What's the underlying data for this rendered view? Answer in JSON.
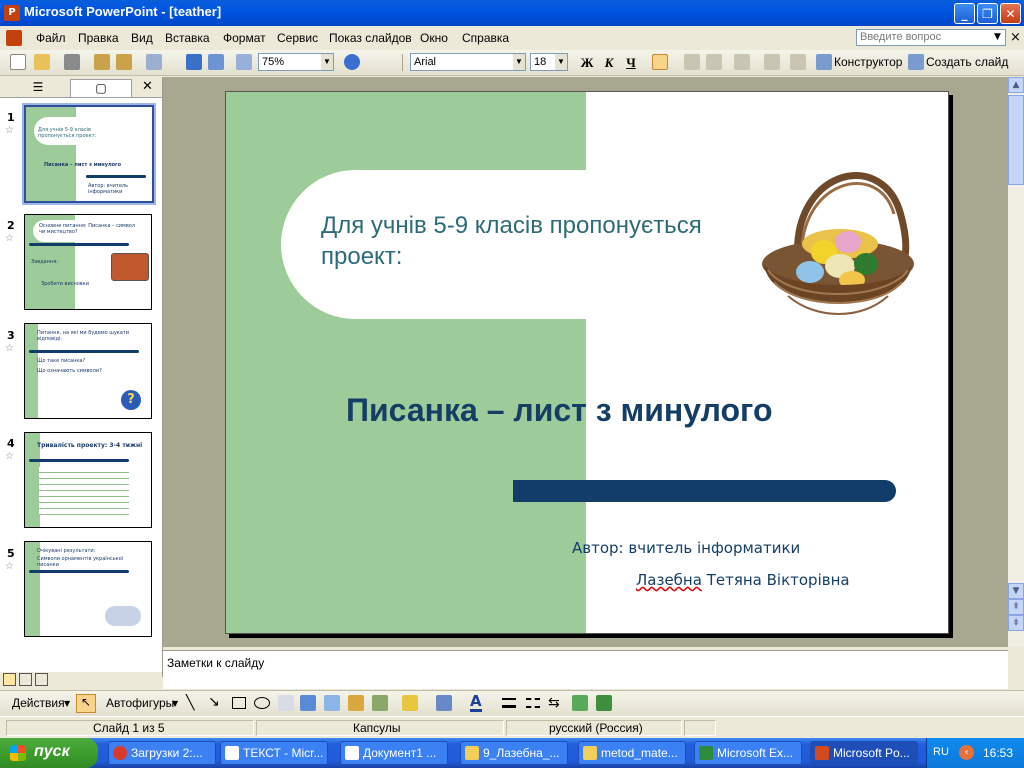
{
  "window": {
    "title": "Microsoft PowerPoint - [teather]",
    "min": "_",
    "max": "❐",
    "close": "✕"
  },
  "menu": {
    "items": [
      "Файл",
      "Правка",
      "Вид",
      "Вставка",
      "Формат",
      "Сервис",
      "Показ слайдов",
      "Окно",
      "Справка"
    ],
    "help_placeholder": "Введите вопрос",
    "close": "×"
  },
  "toolbar": {
    "zoom": "75%",
    "font": "Arial",
    "size": "18",
    "bold": "Ж",
    "italic": "К",
    "underline": "Ч",
    "designer": "Конструктор",
    "new_slide": "Создать слайд"
  },
  "panel": {
    "close": "✕",
    "outline_tab": "☰",
    "slides_tab": "▢",
    "slides": [
      {
        "num": "1",
        "text1": "Для учнів 5-9 класів пропонується проект:",
        "text2": "Писанка – лист з минулого",
        "text3": "Автор: вчитель інформатики"
      },
      {
        "num": "2",
        "text1": "Основне питання: Писанка – символ чи мистецтво?",
        "text2": "Завдання:",
        "text3": "Зробити висновки"
      },
      {
        "num": "3",
        "text1": "Питання, на які ми будемо шукати відповіді:",
        "text2": "Що таке писанка?",
        "text3": "Що означають символи?"
      },
      {
        "num": "4",
        "text1": "Тривалість проекту: 3-4 тижні",
        "text2": "",
        "text3": ""
      },
      {
        "num": "5",
        "text1": "Очікувані результати:",
        "text2": "Символи орнаментів української писанки",
        "text3": ""
      }
    ]
  },
  "slide": {
    "subtitle": "Для учнів 5-9 класів пропонується проект:",
    "title": "Писанка – лист з минулого",
    "author_line1": "Автор: вчитель інформатики",
    "author_name_first": "Лазебна",
    "author_name_rest": " Тетяна Вікторівна"
  },
  "notes": {
    "placeholder": "Заметки к слайду"
  },
  "drawbar": {
    "actions": "Действия",
    "autoshapes": "Автофигуры"
  },
  "status": {
    "slide": "Слайд 1 из 5",
    "design": "Капсулы",
    "lang": "русский (Россия)"
  },
  "taskbar": {
    "start": "пуск",
    "tasks": [
      "Загрузки 2:...",
      "ТЕКСТ - Micr...",
      "Документ1 ...",
      "9_Лазебна_...",
      "metod_mate...",
      "Microsoft Ex...",
      "Microsoft Po..."
    ],
    "lang": "RU",
    "time": "16:53"
  },
  "colors": {
    "accent_green": "#9DCB9A",
    "accent_navy": "#123C6A",
    "title_teal": "#2E6B7A"
  }
}
